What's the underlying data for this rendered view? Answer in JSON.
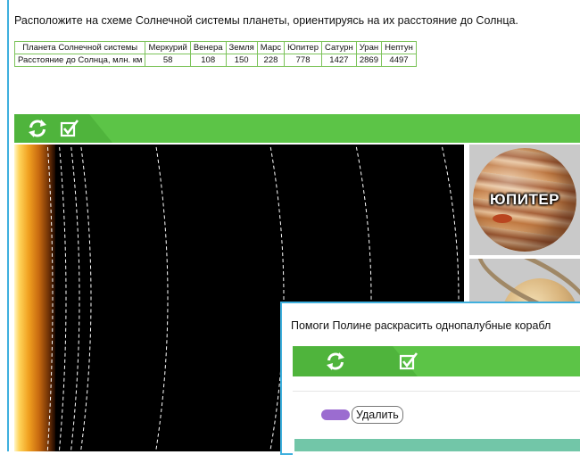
{
  "task": {
    "instruction": "Расположите на схеме Солнечной системы планеты, ориентируясь на их расстояние до Солнца."
  },
  "table": {
    "header_label": "Планета Солнечной системы",
    "row_label": "Расстояние до Солнца, млн. км",
    "planets": [
      "Меркурий",
      "Венера",
      "Земля",
      "Марс",
      "Юпитер",
      "Сатурн",
      "Уран",
      "Нептун"
    ],
    "distances": [
      "58",
      "108",
      "150",
      "228",
      "778",
      "1427",
      "2869",
      "4497"
    ]
  },
  "toolbar": {
    "reset_icon": "refresh-icon",
    "check_icon": "checkbox-check-icon"
  },
  "cards": {
    "jupiter_label": "ЮПИТЕР"
  },
  "dialog": {
    "text": "Помоги Полине раскрасить однопалубные корабл",
    "delete_label": "Удалить",
    "swatch_color": "#9b6cd0"
  },
  "colors": {
    "accent_green": "#5cc447",
    "frame_blue": "#3fb0de",
    "teal": "#72c6a8"
  }
}
